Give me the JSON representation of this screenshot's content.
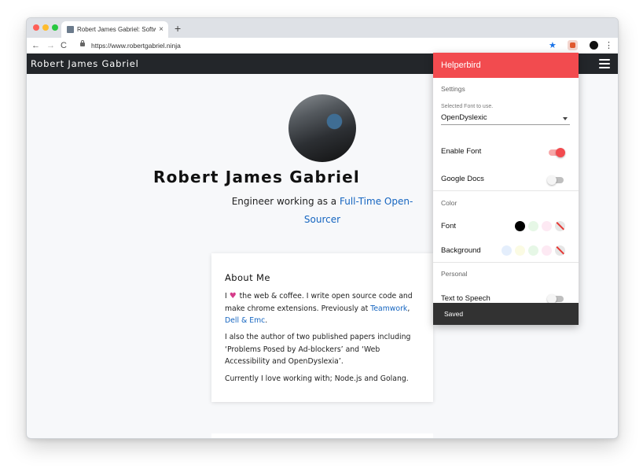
{
  "browser": {
    "tab_title": "Robert James Gabriel: Software",
    "tab_close": "×",
    "new_tab": "+",
    "url": "https://www.robertgabriel.ninja",
    "back": "←",
    "forward": "→",
    "reload": "C",
    "star": "★",
    "menu": "⋮"
  },
  "site": {
    "brand": "Robert James Gabriel",
    "name": "Robert James Gabriel",
    "tagline_prefix": "Engineer working as a ",
    "tagline_link": "Full-Time Open-Sourcer"
  },
  "about": {
    "heading": "About Me",
    "p1_i": "I ",
    "p1_after_heart": " the web & coffee. I write open source code and make chrome extensions. Previously at ",
    "teamwork": "Teamwork",
    "comma": ", ",
    "dell": "Dell & Emc",
    "period": ".",
    "p2": "I also the author of two published papers including ‘Problems Posed by Ad-blockers’ and ‘Web Accessibility and OpenDyslexia’.",
    "p3": "Currently I love working with; Node.js and Golang."
  },
  "helperbird": {
    "title": "Helperbird",
    "settings": "Settings",
    "font_select_label": "Selected Font to use.",
    "font_value": "OpenDyslexic",
    "enable_font": "Enable Font",
    "enable_font_on": true,
    "google_docs": "Google Docs",
    "google_docs_on": false,
    "color_section": "Color",
    "font_color_label": "Font",
    "font_colors": [
      "#000000",
      "#e6f7e6",
      "#fde9f3"
    ],
    "background_label": "Background",
    "background_colors": [
      "#e4eefc",
      "#fbfbe3",
      "#e6f7e6",
      "#fde9f3"
    ],
    "personal": "Personal",
    "tts": "Text to Speech",
    "tts_on": false,
    "snackbar": "Saved"
  },
  "colors": {
    "accent": "#f24b4f",
    "nav_bg": "#23262a",
    "link": "#1565c0"
  }
}
